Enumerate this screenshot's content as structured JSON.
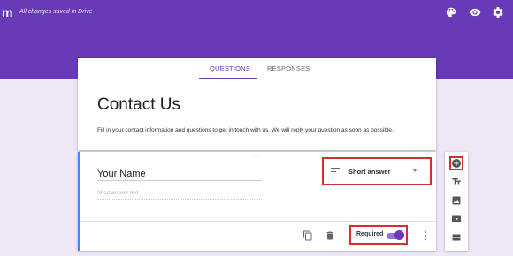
{
  "header": {
    "logo": "m",
    "save_status": "All changes saved in Drive",
    "icons": [
      "palette-icon",
      "preview-eye-icon",
      "settings-gear-icon"
    ]
  },
  "tabs": [
    {
      "label": "QUESTIONS",
      "active": true
    },
    {
      "label": "RESPONSES",
      "active": false
    }
  ],
  "form": {
    "title": "Contact Us",
    "description": "Fill in your contact information and questions to get in touch with us. We will reply your question as soon as possible."
  },
  "question": {
    "drag_handle": ":::",
    "title": "Your Name",
    "answer_placeholder": "Short answer text",
    "type": "Short answer",
    "required_label": "Required",
    "required": true,
    "actions": [
      "duplicate-icon",
      "delete-icon",
      "more-vert-icon"
    ]
  },
  "side_toolbar": {
    "tools": [
      "add-question-icon",
      "add-title-icon",
      "add-image-icon",
      "add-video-icon",
      "add-section-icon"
    ]
  },
  "colors": {
    "header": "#673ab7",
    "background": "#ede7f6",
    "highlight_box": "#d32f2f",
    "accent": "#673ab7",
    "question_border": "#4285f4"
  }
}
